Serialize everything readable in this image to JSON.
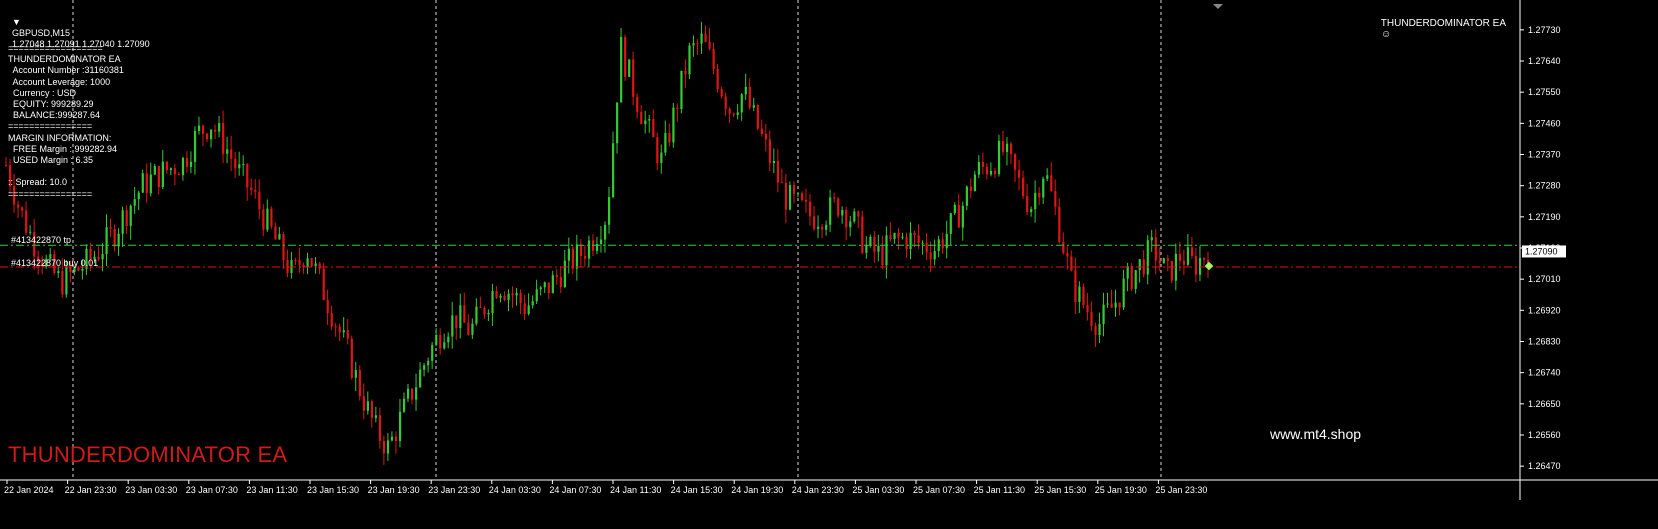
{
  "header": {
    "symbol": "GBPUSD,M15",
    "ohlc": "1.27048 1.27091 1.27040 1.27090",
    "ea_name": "THUNDERDOMINATOR EA"
  },
  "info_panel": {
    "lines": [
      "==================",
      "THUNDERDOMINATOR EA",
      "  Account Number :31160381",
      "  Account Leverage: 1000",
      "  Currency : USD",
      "  EQUITY: 999289.29",
      "  BALANCE:999287.64",
      "================",
      "MARGIN INFORMATION:",
      "  FREE Margin : 999282.94",
      "  USED Margin : 6.35",
      "",
      ":: Spread: 10.0",
      "================"
    ]
  },
  "orders": {
    "tp_label": "#413422870 tp",
    "buy_label": "#413422870 buy 0.01"
  },
  "overlay": {
    "big_title": "THUNDERDOMINATOR EA",
    "site": "www.mt4.shop"
  },
  "colors": {
    "bull": "#33cc33",
    "bear": "#e01515",
    "tp_line": "#33cc33",
    "entry_line": "#e01515",
    "grid": "#ffffff",
    "axis_text": "#ffffff"
  },
  "chart_data": {
    "type": "candlestick",
    "price_levels": [
      1.2773,
      1.2764,
      1.2755,
      1.2746,
      1.2737,
      1.2728,
      1.2719,
      1.271,
      1.2701,
      1.2692,
      1.2683,
      1.2674,
      1.2665,
      1.2656,
      1.2647
    ],
    "price_labels": [
      "1.27730",
      "1.27640",
      "1.27550",
      "1.27460",
      "1.27370",
      "1.27280",
      "1.27190",
      "1.27100",
      "1.27010",
      "1.26920",
      "1.26830",
      "1.26740",
      "1.26650",
      "1.26560",
      "1.26470"
    ],
    "current_price": 1.2709,
    "current_price_label": "1.27090",
    "tp_price": 1.27108,
    "entry_price": 1.27045,
    "time_labels": [
      "22 Jan 2024",
      "22 Jan 23:30",
      "23 Jan 03:30",
      "23 Jan 07:30",
      "23 Jan 11:30",
      "23 Jan 15:30",
      "23 Jan 19:30",
      "23 Jan 23:30",
      "24 Jan 03:30",
      "24 Jan 07:30",
      "24 Jan 11:30",
      "24 Jan 15:30",
      "24 Jan 19:30",
      "24 Jan 23:30",
      "25 Jan 03:30",
      "25 Jan 07:30",
      "25 Jan 11:30",
      "25 Jan 15:30",
      "25 Jan 19:30",
      "25 Jan 23:30"
    ],
    "closes": [
      1.2734,
      1.2721,
      1.2712,
      1.2705,
      1.27,
      1.2703,
      1.2706,
      1.271,
      1.2715,
      1.2722,
      1.2728,
      1.2731,
      1.2733,
      1.2735,
      1.2743,
      1.2746,
      1.274,
      1.2732,
      1.2726,
      1.2718,
      1.271,
      1.2702,
      1.271,
      1.27,
      1.269,
      1.268,
      1.2668,
      1.2658,
      1.2652,
      1.2662,
      1.2671,
      1.268,
      1.2687,
      1.269,
      1.2686,
      1.2693,
      1.27,
      1.2697,
      1.2693,
      1.2696,
      1.27,
      1.2705,
      1.2708,
      1.2713,
      1.272,
      1.2768,
      1.2755,
      1.2744,
      1.2735,
      1.275,
      1.2766,
      1.277,
      1.276,
      1.275,
      1.2755,
      1.2745,
      1.2735,
      1.2725,
      1.2722,
      1.2719,
      1.272,
      1.2723,
      1.2718,
      1.271,
      1.2708,
      1.2712,
      1.2713,
      1.2711,
      1.271,
      1.2715,
      1.2722,
      1.2732,
      1.2734,
      1.2738,
      1.273,
      1.2722,
      1.2733,
      1.2718,
      1.27,
      1.2693,
      1.2688,
      1.2693,
      1.27,
      1.2705,
      1.271,
      1.2702,
      1.2708,
      1.2705,
      1.2709
    ],
    "xlabel": "",
    "ylabel": ""
  }
}
